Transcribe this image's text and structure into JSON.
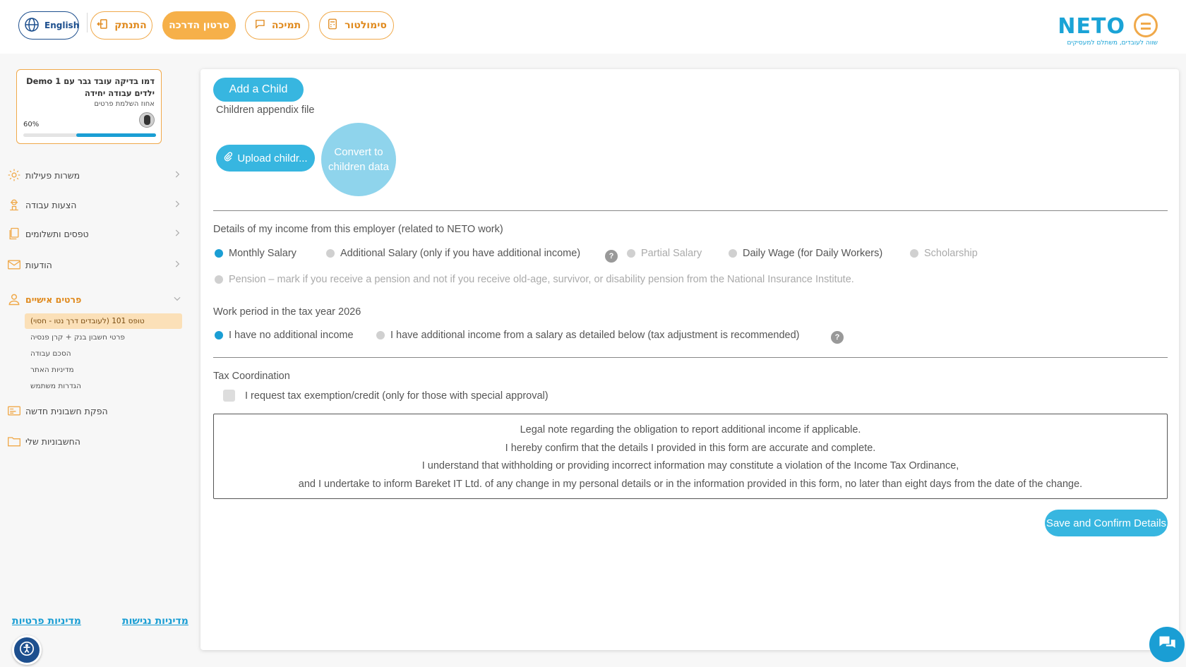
{
  "header": {
    "language_label": "English",
    "logout_label": "התנתק",
    "tutorial_label": "סרטון הדרכה",
    "support_label": "תמיכה",
    "simulator_label": "סימולטור",
    "logo_text": "NETO",
    "logo_tagline": "שווה לעובדים, משתלם למעסיקים",
    "brand_orange": "#f0a94a",
    "brand_blue": "#1aa3d6"
  },
  "sidebar": {
    "profile": {
      "name": "דמו בדיקה עובד גבר עם Demo 1 ילדים עבודה יחידה",
      "subtitle": "אחוז השלמת פרטים",
      "percent_label": "60%",
      "percent": 60
    },
    "items": [
      {
        "label": "משרות פעילות",
        "icon": "gear-icon"
      },
      {
        "label": "הצעות עבודה",
        "icon": "worker-icon"
      },
      {
        "label": "טפסים ותשלומים",
        "icon": "document-icon"
      },
      {
        "label": "הודעות",
        "icon": "envelope-icon"
      },
      {
        "label": "פרטים אישיים",
        "icon": "user-icon"
      }
    ],
    "subitems": [
      {
        "label": "טופס 101 (לעובדים דרך נטו - חסוי)"
      },
      {
        "label": "פרטי חשבון בנק + קרן פנסיה"
      },
      {
        "label": "הסכם עבודה"
      },
      {
        "label": "מדיניות האתר"
      },
      {
        "label": "הגדרות משתמש"
      }
    ],
    "extra_items": [
      {
        "label": "הפקת חשבונית חדשה",
        "icon": "invoice-icon"
      },
      {
        "label": "החשבוניות שלי",
        "icon": "folder-icon"
      }
    ],
    "footer": {
      "privacy_label": "מדיניות פרטיות",
      "accessibility_label": "מדיניות נגישות"
    }
  },
  "main": {
    "add_child_label": "Add a Child",
    "children_appendix_label": "Children appendix file",
    "upload_label": "Upload childr...",
    "convert_label": "Convert to children data",
    "income_section_title": "Details of my income from this employer (related to NETO work)",
    "income_options": [
      {
        "label": "Monthly Salary",
        "checked": true
      },
      {
        "label": "Additional Salary (only if you have additional income)",
        "checked": false
      },
      {
        "label": "Partial Salary",
        "checked": false,
        "disabled": true
      },
      {
        "label": "Daily Wage (for Daily Workers)",
        "checked": false
      },
      {
        "label": "Scholarship",
        "checked": false,
        "disabled": true
      },
      {
        "label": "Pension – mark if you receive a pension and not if you receive old-age, survivor, or disability pension from the National Insurance Institute.",
        "checked": false,
        "disabled": true
      }
    ],
    "help_label": "?",
    "work_period_title": "Work period in the tax year 2026",
    "work_options": [
      {
        "label": "I have no additional income",
        "checked": true
      },
      {
        "label": "I have additional income from a salary as detailed below (tax adjustment is recommended)",
        "checked": false
      }
    ],
    "tax_coordination_title": "Tax Coordination",
    "tax_exemption_label": "I request tax exemption/credit (only for those with special approval)",
    "legal_lines": [
      "Legal note regarding the obligation to report additional income if applicable.",
      "I hereby confirm that the details I provided in this form are accurate and complete.",
      "I understand that withholding or providing incorrect information may constitute a violation of the Income Tax Ordinance,",
      "and I undertake to inform Bareket IT Ltd. of any change in my personal details or in the information provided in this form, no later than eight days from the date of the change."
    ],
    "save_label": "Save and Confirm Details"
  }
}
